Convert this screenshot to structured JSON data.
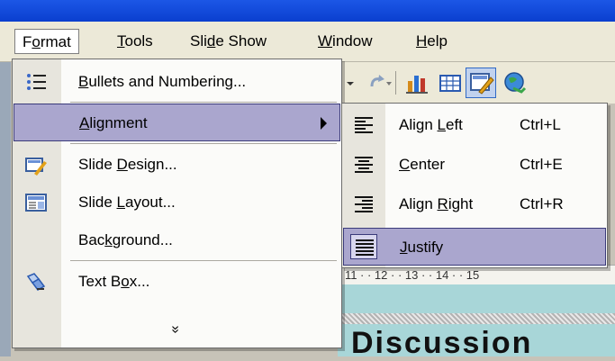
{
  "menubar": {
    "items": [
      {
        "label": "Format",
        "u": 1
      },
      {
        "label": "Tools",
        "u": 0
      },
      {
        "label": "Slide Show",
        "u": 3
      },
      {
        "label": "Window",
        "u": 0
      },
      {
        "label": "Help",
        "u": 0
      }
    ]
  },
  "format_menu": {
    "items": [
      {
        "label": "Bullets and Numbering...",
        "u": 0,
        "icon": "bullets-icon"
      },
      {
        "label": "Alignment",
        "u": 0,
        "icon": "",
        "submenu": true
      },
      {
        "label": "Slide Design...",
        "u": 6,
        "icon": "slide-design-icon"
      },
      {
        "label": "Slide Layout...",
        "u": 6,
        "icon": "slide-layout-icon"
      },
      {
        "label": "Background...",
        "u": 3,
        "icon": ""
      },
      {
        "label": "Text Box...",
        "u": 6,
        "icon": "text-box-icon"
      }
    ],
    "expand_glyph": "»"
  },
  "alignment_submenu": {
    "items": [
      {
        "label": "Align Left",
        "u": 6,
        "shortcut": "Ctrl+L",
        "icon": "align-left-icon"
      },
      {
        "label": "Center",
        "u": 0,
        "shortcut": "Ctrl+E",
        "icon": "align-center-icon"
      },
      {
        "label": "Align Right",
        "u": 6,
        "shortcut": "Ctrl+R",
        "icon": "align-right-icon"
      },
      {
        "label": "Justify",
        "u": 0,
        "shortcut": "",
        "icon": "justify-icon"
      }
    ]
  },
  "ruler": {
    "ticks": "· 11 · · 12 · · 13 · · 14 · · 15"
  },
  "slide": {
    "text": "Discussion"
  }
}
